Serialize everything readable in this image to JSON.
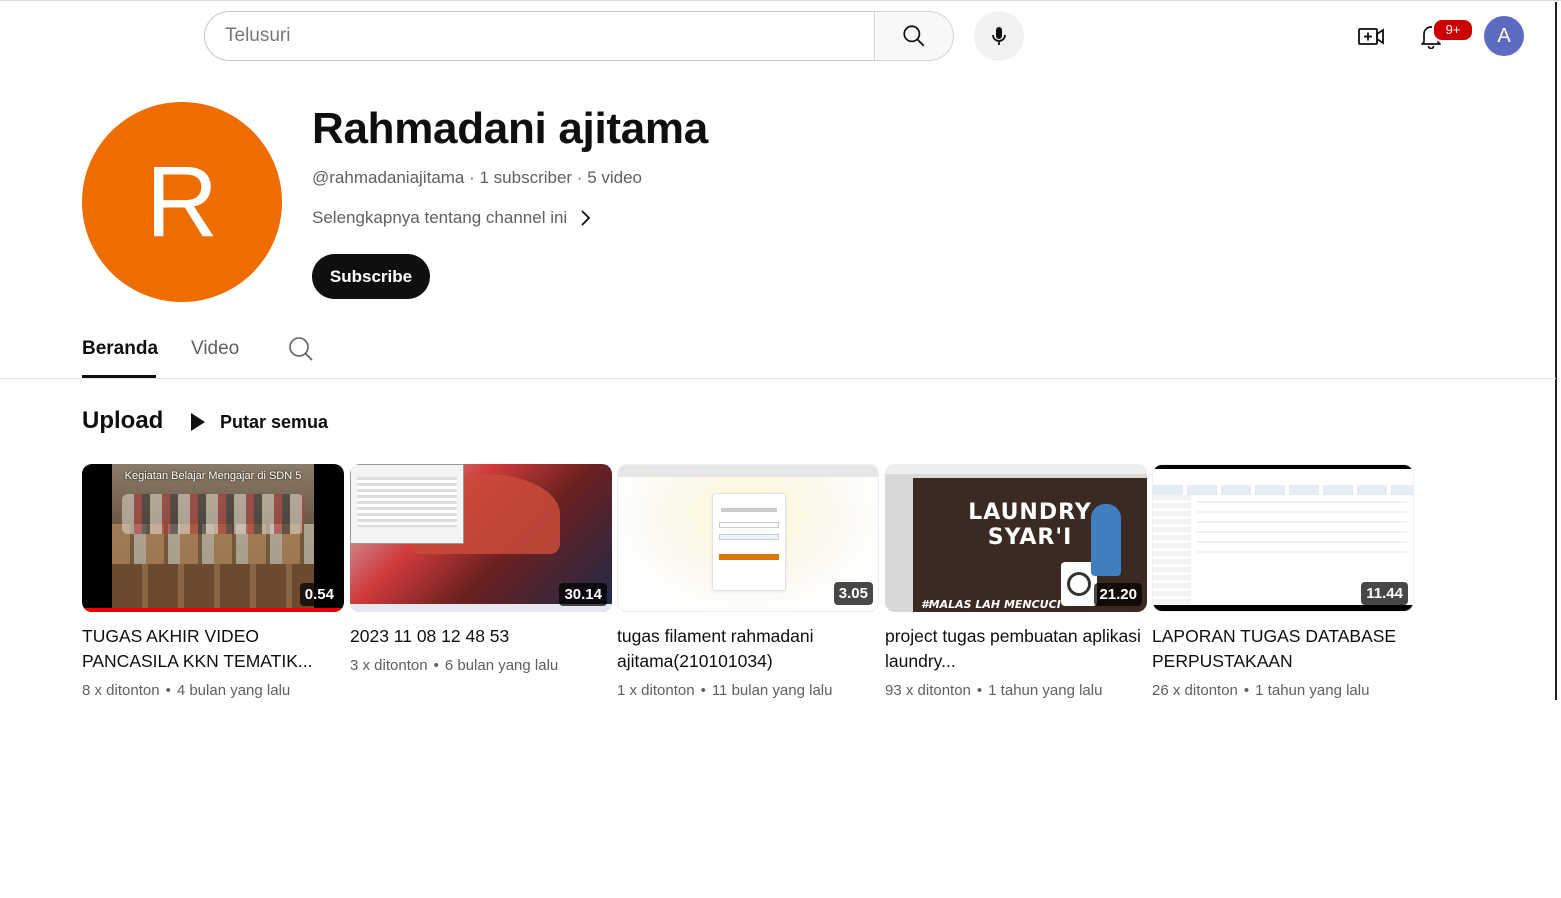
{
  "header": {
    "search_placeholder": "Telusuri",
    "notification_badge": "9+",
    "account_initial": "A"
  },
  "channel": {
    "avatar_initial": "R",
    "avatar_color": "#ef6c00",
    "name": "Rahmadani ajitama",
    "meta": "@rahmadaniajitama · 1 subscriber · 5 video",
    "more_link": "Selengkapnya tentang channel ini",
    "subscribe_label": "Subscribe"
  },
  "tabs": [
    {
      "label": "Beranda",
      "active": true
    },
    {
      "label": "Video",
      "active": false
    }
  ],
  "shelf": {
    "title": "Upload",
    "play_all_label": "Putar semua"
  },
  "videos": [
    {
      "title": "TUGAS AKHIR VIDEO PANCASILA KKN TEMATIK...",
      "duration": "0.54",
      "views": "8 x ditonton",
      "age": "4 bulan yang lalu",
      "thumb_caption": "Kegiatan Belajar Mengajar di SDN 5",
      "watched_fraction": 1.0
    },
    {
      "title": "2023 11 08 12 48 53",
      "duration": "30.14",
      "views": "3 x ditonton",
      "age": "6 bulan yang lalu"
    },
    {
      "title": "tugas filament rahmadani ajitama(210101034)",
      "duration": "3.05",
      "views": "1 x ditonton",
      "age": "11 bulan yang lalu"
    },
    {
      "title": "project tugas pembuatan aplikasi laundry...",
      "duration": "21.20",
      "views": "93 x ditonton",
      "age": "1 tahun yang lalu",
      "thumb_caption": "LAUNDRY SYAR'I",
      "thumb_caption2": "#MALAS LAH MENCUCI"
    },
    {
      "title": "LAPORAN TUGAS DATABASE PERPUSTAKAAN",
      "duration": "11.44",
      "views": "26 x ditonton",
      "age": "1 tahun yang lalu"
    }
  ]
}
